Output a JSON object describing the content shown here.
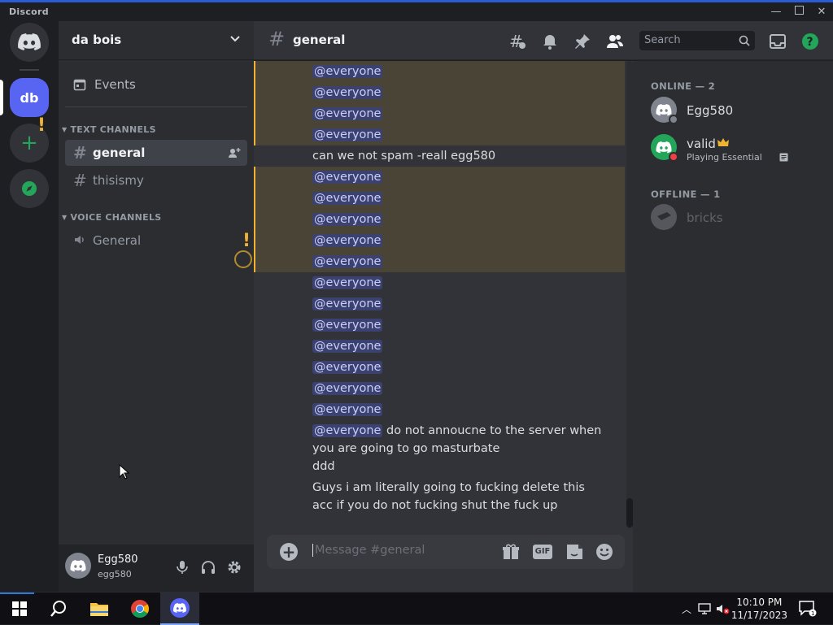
{
  "window": {
    "app_title": "Discord"
  },
  "rail": {
    "server_initials": "db"
  },
  "guild": {
    "name": "da bois",
    "events_label": "Events",
    "categories": {
      "text": "TEXT CHANNELS",
      "voice": "VOICE CHANNELS"
    },
    "channels": [
      {
        "name": "general",
        "type": "text",
        "active": true
      },
      {
        "name": "thisismy",
        "type": "text",
        "active": false
      },
      {
        "name": "General",
        "type": "voice",
        "active": false
      }
    ]
  },
  "user": {
    "display_name": "Egg580",
    "username": "egg580"
  },
  "chat": {
    "channel_name": "general",
    "search_placeholder": "Search",
    "composer_placeholder": "Message #general",
    "messages": [
      {
        "mention": "@everyone",
        "text": "",
        "highlight": true
      },
      {
        "mention": "@everyone",
        "text": "",
        "highlight": true
      },
      {
        "mention": "@everyone",
        "text": "",
        "highlight": true
      },
      {
        "mention": "@everyone",
        "text": "",
        "highlight": true
      },
      {
        "mention": "",
        "text": "can we not spam -reall egg580",
        "highlight": false
      },
      {
        "mention": "@everyone",
        "text": "",
        "highlight": true
      },
      {
        "mention": "@everyone",
        "text": "",
        "highlight": true
      },
      {
        "mention": "@everyone",
        "text": "",
        "highlight": true
      },
      {
        "mention": "@everyone",
        "text": "",
        "highlight": true
      },
      {
        "mention": "@everyone",
        "text": "",
        "highlight": true
      },
      {
        "mention": "@everyone",
        "text": "",
        "highlight": false
      },
      {
        "mention": "@everyone",
        "text": "",
        "highlight": false
      },
      {
        "mention": "@everyone",
        "text": "",
        "highlight": false
      },
      {
        "mention": "@everyone",
        "text": "",
        "highlight": false
      },
      {
        "mention": "@everyone",
        "text": "",
        "highlight": false
      },
      {
        "mention": "@everyone",
        "text": "",
        "highlight": false
      },
      {
        "mention": "@everyone",
        "text": "",
        "highlight": false
      },
      {
        "mention": "@everyone",
        "text": " do not annoucne to the server when you are going to go masturbate",
        "highlight": false
      },
      {
        "mention": "",
        "text": "ddd",
        "highlight": false
      },
      {
        "mention": "",
        "text": "Guys i am literally going to fucking delete this acc if you do not fucking shut the fuck up",
        "highlight": false
      }
    ]
  },
  "members": {
    "online_label": "ONLINE — 2",
    "offline_label": "OFFLINE — 1",
    "online": [
      {
        "name": "Egg580",
        "activity": "",
        "avatar_color": "#80848e",
        "status_color": "#80848e"
      },
      {
        "name": "valid",
        "activity": "Playing Essential",
        "avatar_color": "#23a55a",
        "status_color": "#f23f43"
      }
    ],
    "offline": [
      {
        "name": "bricks",
        "activity": "",
        "avatar_color": "#b5bac1"
      }
    ]
  },
  "taskbar": {
    "time": "10:10 PM",
    "date": "11/17/2023",
    "notification_count": "1"
  },
  "colors": {
    "blurple": "#5865f2",
    "mention_highlight": "#4a4436",
    "mention_border": "#f0b232",
    "online_green": "#23a55a"
  }
}
